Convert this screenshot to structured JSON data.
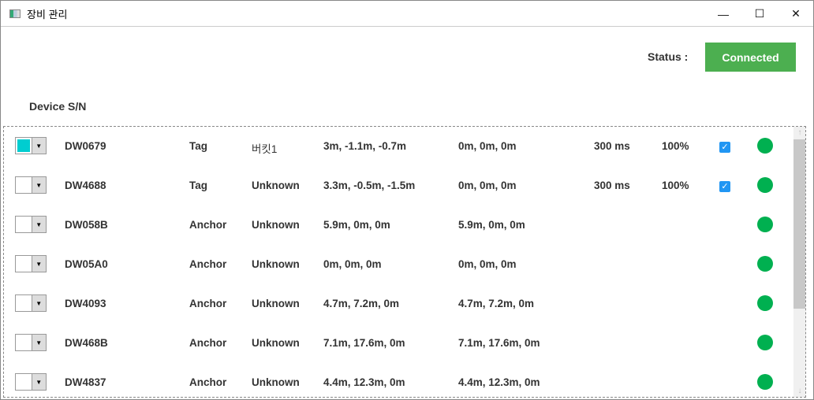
{
  "window": {
    "title": "장비 관리",
    "minimize": "—",
    "maximize": "☐",
    "close": "✕"
  },
  "status": {
    "label": "Status :",
    "value": "Connected",
    "color": "#4caf50"
  },
  "header": {
    "device_sn": "Device S/N"
  },
  "devices": [
    {
      "sn": "DW0679",
      "type": "Tag",
      "name": "버킷1",
      "pos1": "3m, -1.1m, -0.7m",
      "pos2": "0m, 0m, 0m",
      "rate": "300 ms",
      "pct": "100%",
      "checked": true,
      "color": "#00cdd0"
    },
    {
      "sn": "DW4688",
      "type": "Tag",
      "name": "Unknown",
      "pos1": "3.3m, -0.5m, -1.5m",
      "pos2": "0m, 0m, 0m",
      "rate": "300 ms",
      "pct": "100%",
      "checked": true,
      "color": "#ffffff"
    },
    {
      "sn": "DW058B",
      "type": "Anchor",
      "name": "Unknown",
      "pos1": "5.9m, 0m, 0m",
      "pos2": "5.9m, 0m, 0m",
      "color": "#ffffff"
    },
    {
      "sn": "DW05A0",
      "type": "Anchor",
      "name": "Unknown",
      "pos1": "0m, 0m, 0m",
      "pos2": "0m, 0m, 0m",
      "color": "#ffffff"
    },
    {
      "sn": "DW4093",
      "type": "Anchor",
      "name": "Unknown",
      "pos1": "4.7m, 7.2m, 0m",
      "pos2": "4.7m, 7.2m, 0m",
      "color": "#ffffff"
    },
    {
      "sn": "DW468B",
      "type": "Anchor",
      "name": "Unknown",
      "pos1": "7.1m, 17.6m, 0m",
      "pos2": "7.1m, 17.6m, 0m",
      "color": "#ffffff"
    },
    {
      "sn": "DW4837",
      "type": "Anchor",
      "name": "Unknown",
      "pos1": "4.4m, 12.3m, 0m",
      "pos2": "4.4m, 12.3m, 0m",
      "color": "#ffffff"
    }
  ]
}
